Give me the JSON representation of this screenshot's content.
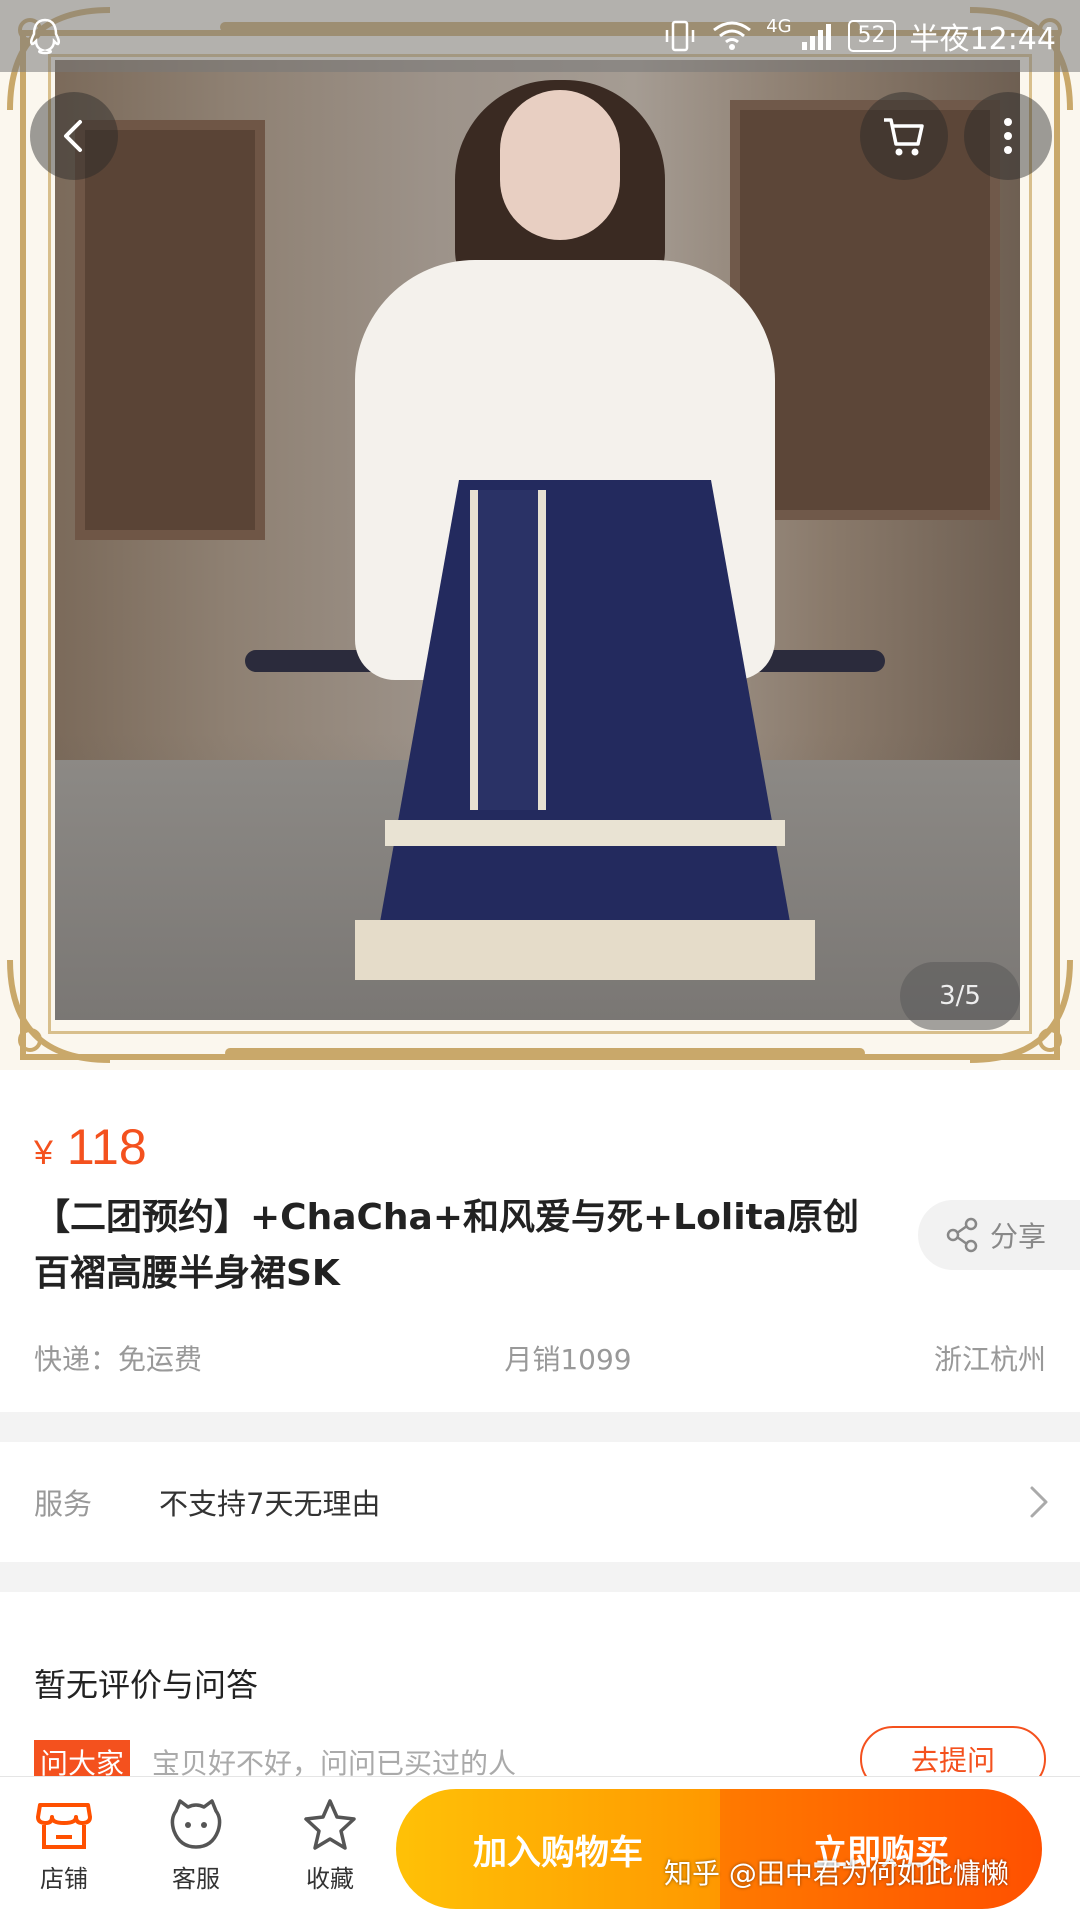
{
  "status_bar": {
    "network": "4G",
    "battery": "52",
    "time": "半夜12:44"
  },
  "gallery": {
    "counter": "3/5"
  },
  "product": {
    "currency": "¥",
    "price": "118",
    "title": "【二团预约】+ChaCha+和风爱与死+Lolita原创百褶高腰半身裙SK",
    "share_label": "分享",
    "shipping": "快递：免运费",
    "monthly_sales": "月销1099",
    "location": "浙江杭州"
  },
  "service": {
    "label": "服务",
    "value": "不支持7天无理由"
  },
  "reviews": {
    "title": "暂无评价与问答",
    "ask_tag": "问大家",
    "ask_text": "宝贝好不好，问问已买过的人",
    "ask_button": "去提问"
  },
  "bottom_bar": {
    "shop": "店铺",
    "service": "客服",
    "favorite": "收藏",
    "add_to_cart": "加入购物车",
    "buy_now": "立即购买"
  },
  "watermark": "知乎 @田中君为何如此慵懒",
  "colors": {
    "accent": "#f4511e",
    "cart_button": "#ffb300",
    "buy_button": "#ff5a00"
  }
}
